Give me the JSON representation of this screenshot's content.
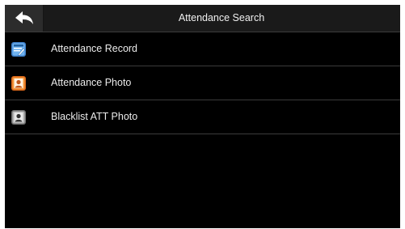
{
  "header": {
    "back_icon": "back-arrow-icon",
    "title": "Attendance Search"
  },
  "menu": {
    "items": [
      {
        "label": "Attendance Record",
        "icon": "attendance-record-icon",
        "color": "#4a90d9"
      },
      {
        "label": "Attendance Photo",
        "icon": "attendance-photo-icon",
        "color": "#e8791c"
      },
      {
        "label": "Blacklist ATT Photo",
        "icon": "blacklist-photo-icon",
        "color": "#8a8a8a"
      }
    ]
  },
  "colors": {
    "background": "#000000",
    "titlebar": "#1a1a1a",
    "divider": "#3b3b3b",
    "text": "#ececec"
  }
}
